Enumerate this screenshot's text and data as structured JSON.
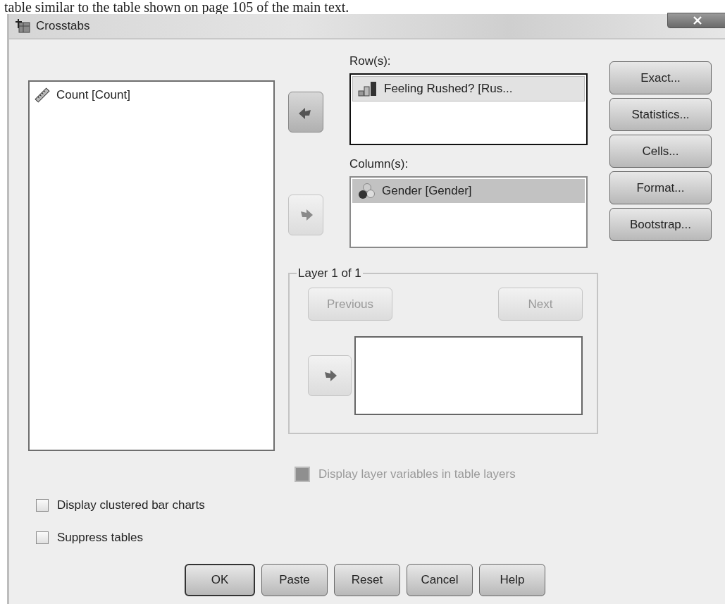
{
  "page_text": "table similar to the table shown on page 105 of the main text.",
  "window": {
    "title": "Crosstabs"
  },
  "variables": [
    {
      "name": "Count [Count]",
      "kind": "scale",
      "selected": false
    }
  ],
  "rows": {
    "label": "Row(s):",
    "focused": true,
    "move": {
      "kind": "left",
      "disabled": false
    },
    "items": [
      {
        "name": "Feeling Rushed? [Rus...",
        "kind": "ordinal",
        "selected": true
      }
    ]
  },
  "columns": {
    "label": "Column(s):",
    "focused": false,
    "move": {
      "kind": "right",
      "disabled": true
    },
    "items": [
      {
        "name": "Gender [Gender]",
        "kind": "nominal",
        "selected": true
      }
    ]
  },
  "side_buttons": [
    "Exact...",
    "Statistics...",
    "Cells...",
    "Format...",
    "Bootstrap..."
  ],
  "layer": {
    "title": "Layer 1 of 1",
    "previous": {
      "label": "Previous",
      "disabled": true
    },
    "next": {
      "label": "Next",
      "disabled": true
    },
    "move": {
      "kind": "right",
      "disabled": true
    }
  },
  "layer_option": {
    "label": "Display layer variables in table layers",
    "checked": false,
    "disabled": true
  },
  "options": [
    {
      "label": "Display clustered bar charts",
      "checked": false,
      "disabled": false
    },
    {
      "label": "Suppress tables",
      "checked": false,
      "disabled": false
    }
  ],
  "buttons": [
    {
      "label": "OK",
      "default": true
    },
    {
      "label": "Paste",
      "default": false
    },
    {
      "label": "Reset",
      "default": false
    },
    {
      "label": "Cancel",
      "default": false
    },
    {
      "label": "Help",
      "default": false
    }
  ]
}
